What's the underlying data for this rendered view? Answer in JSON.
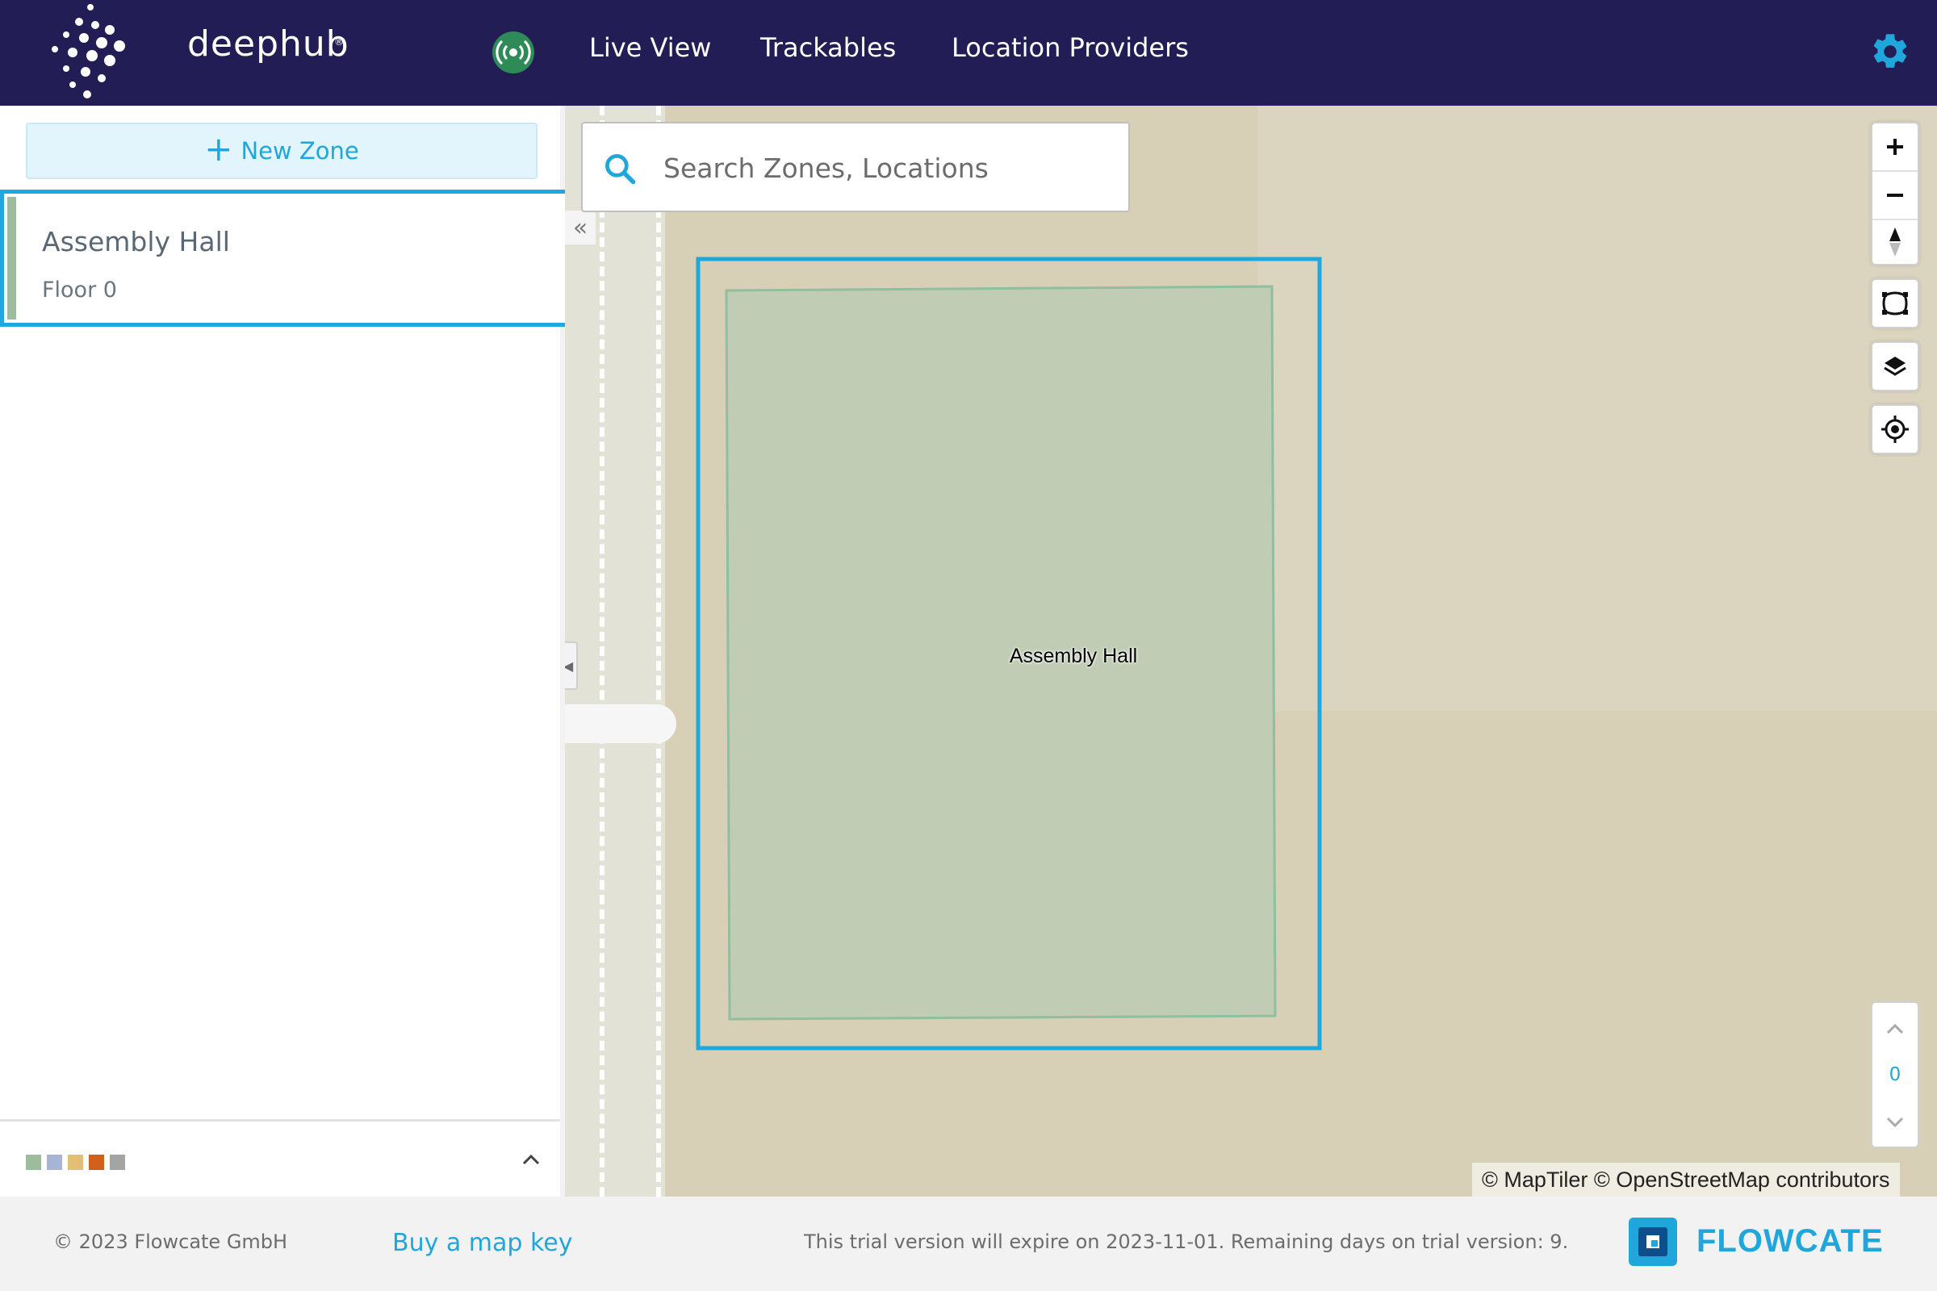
{
  "brand": {
    "name": "deephub",
    "reg_mark": "®"
  },
  "nav": {
    "links": [
      "Live View",
      "Trackables",
      "Location Providers"
    ]
  },
  "colors": {
    "nav_bg": "#221d54",
    "accent": "#1fa7dc",
    "zone_fill": "#c0ccb4",
    "live_indicator": "#2e8b57"
  },
  "icons": {
    "live": "broadcast-icon",
    "settings": "gear-icon",
    "search": "search-icon",
    "zoom_in": "plus-icon",
    "zoom_out": "minus-icon",
    "compass": "compass-icon",
    "fit": "fit-bounds-icon",
    "layers": "layers-icon",
    "locate": "locate-icon"
  },
  "sidebar": {
    "new_zone_label": "New Zone",
    "zones": [
      {
        "name": "Assembly Hall",
        "floor": "Floor 0",
        "color": "#9dbb9d"
      }
    ],
    "legend_colors": [
      "#9dbb9d",
      "#a8b4d6",
      "#e3bf76",
      "#d2601a",
      "#a4a4a4"
    ]
  },
  "map": {
    "search_placeholder": "Search Zones, Locations",
    "zone_label": "Assembly Hall",
    "floor_value": "0",
    "attribution": "© MapTiler © OpenStreetMap contributors"
  },
  "footer": {
    "copyright": "© 2023 Flowcate GmbH",
    "buy_link": "Buy a map key",
    "trial_notice": "This trial version will expire on 2023-11-01. Remaining days on trial version: 9.",
    "company": "FLOWCATE"
  }
}
